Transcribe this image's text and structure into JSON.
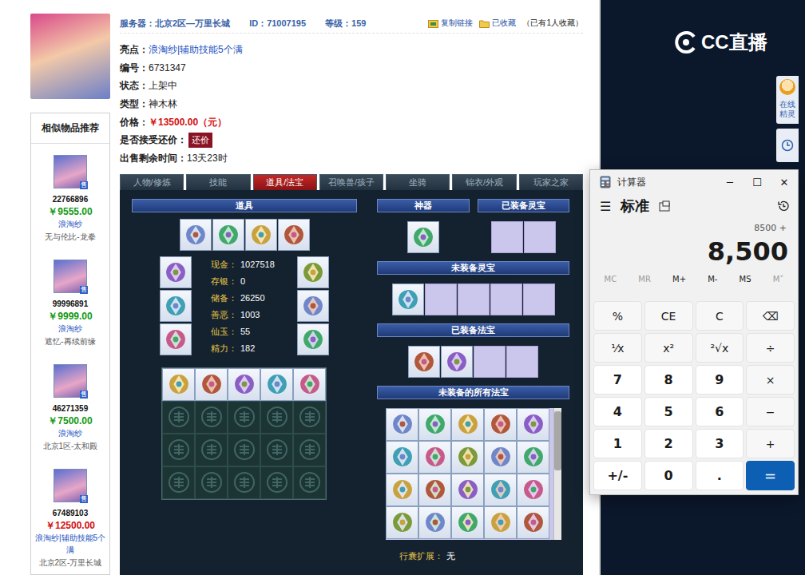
{
  "header": {
    "server": "服务器：北京2区—万里长城",
    "id": "ID：71007195",
    "level": "等级：159",
    "copy_link": "复制链接",
    "favorite": "已收藏",
    "favorite_count": "（已有1人收藏）"
  },
  "info": [
    {
      "label": "亮点：",
      "value": "浪淘纱|辅助技能5个满",
      "kind": "link"
    },
    {
      "label": "编号：",
      "value": "6731347",
      "kind": "text"
    },
    {
      "label": "状态：",
      "value": "上架中",
      "kind": "text"
    },
    {
      "label": "类型：",
      "value": "神木林",
      "kind": "text"
    },
    {
      "label": "价格：",
      "value": "￥13500.00（元）",
      "kind": "price"
    },
    {
      "label": "是否接受还价：",
      "value": "还价",
      "kind": "button"
    },
    {
      "label": "出售剩余时间：",
      "value": "13天23时",
      "kind": "text"
    }
  ],
  "similar": {
    "title": "相似物品推荐",
    "items": [
      {
        "id": "22766896",
        "price": "￥9555.00",
        "color": "#139a13",
        "tag": "浪淘纱",
        "server": "无与伦比-龙拳",
        "badge": "售"
      },
      {
        "id": "99996891",
        "price": "￥9999.00",
        "color": "#139a13",
        "tag": "浪淘纱",
        "server": "遮忆-再续前缘",
        "badge": "售"
      },
      {
        "id": "46271359",
        "price": "￥7500.00",
        "color": "#139a13",
        "tag": "浪淘纱",
        "server": "北京1区-太和殿",
        "badge": "售"
      },
      {
        "id": "67489103",
        "price": "￥12500.00",
        "color": "#d41010",
        "tag": "浪淘纱|辅助技能5个满",
        "server": "北京2区-万里长城",
        "badge": "售"
      }
    ]
  },
  "tabs": [
    {
      "label": "人物/修炼",
      "selected": false
    },
    {
      "label": "技能",
      "selected": false
    },
    {
      "label": "道具/法宝",
      "selected": true
    },
    {
      "label": "召唤兽/孩子",
      "selected": false
    },
    {
      "label": "坐骑",
      "selected": false
    },
    {
      "label": "锦衣/外观",
      "selected": false
    },
    {
      "label": "玩家之家",
      "selected": false
    }
  ],
  "items_panel": {
    "title": "道具",
    "equip_top": [
      {
        "filled": true
      },
      {
        "filled": true
      },
      {
        "filled": true
      },
      {
        "filled": true
      }
    ],
    "equip_left": [
      {
        "filled": true
      },
      {
        "filled": true
      },
      {
        "filled": true
      }
    ],
    "equip_right": [
      {
        "filled": true
      },
      {
        "filled": true
      },
      {
        "filled": true
      }
    ],
    "stats": [
      {
        "label": "现金：",
        "value": "1027518"
      },
      {
        "label": "存银：",
        "value": "0"
      },
      {
        "label": "储备：",
        "value": "26250"
      },
      {
        "label": "善恶：",
        "value": "1003"
      },
      {
        "label": "仙玉：",
        "value": "55"
      },
      {
        "label": "精力：",
        "value": "182"
      }
    ],
    "bag": [
      {
        "filled": true
      },
      {
        "filled": true
      },
      {
        "filled": true
      },
      {
        "filled": true
      },
      {
        "filled": true
      },
      {
        "filled": false
      },
      {
        "filled": false
      },
      {
        "filled": false
      },
      {
        "filled": false
      },
      {
        "filled": false
      },
      {
        "filled": false
      },
      {
        "filled": false
      },
      {
        "filled": false
      },
      {
        "filled": false
      },
      {
        "filled": false
      },
      {
        "filled": false
      },
      {
        "filled": false
      },
      {
        "filled": false
      },
      {
        "filled": false
      },
      {
        "filled": false
      }
    ]
  },
  "artifact": {
    "title": "神器",
    "slots": [
      {
        "filled": true
      }
    ]
  },
  "equipped_lingbao": {
    "title": "已装备灵宝",
    "slots": [
      {
        "filled": false
      },
      {
        "filled": false
      }
    ]
  },
  "unequipped_lingbao": {
    "title": "未装备灵宝",
    "slots": [
      {
        "filled": true
      },
      {
        "filled": false
      },
      {
        "filled": false
      },
      {
        "filled": false
      },
      {
        "filled": false
      }
    ]
  },
  "equipped_fabao": {
    "title": "已装备法宝",
    "slots": [
      {
        "filled": true
      },
      {
        "filled": true
      },
      {
        "filled": false
      },
      {
        "filled": false
      }
    ]
  },
  "all_fabao": {
    "title": "未装备的所有法宝",
    "scroll_level": 0.45,
    "slots": [
      {
        "filled": true
      },
      {
        "filled": true
      },
      {
        "filled": true
      },
      {
        "filled": true
      },
      {
        "filled": true
      },
      {
        "filled": true
      },
      {
        "filled": true
      },
      {
        "filled": true
      },
      {
        "filled": true
      },
      {
        "filled": true
      },
      {
        "filled": true
      },
      {
        "filled": true
      },
      {
        "filled": true
      },
      {
        "filled": true
      },
      {
        "filled": true
      },
      {
        "filled": true
      },
      {
        "filled": true
      },
      {
        "filled": true
      },
      {
        "filled": true
      },
      {
        "filled": true
      }
    ]
  },
  "bag_expansion": {
    "label": "行囊扩展：",
    "value": "无"
  },
  "brand": {
    "logo": "CC直播"
  },
  "side_tab": {
    "label": "在线精灵"
  },
  "calculator": {
    "title": "计算器",
    "controls": [
      "─",
      "☐",
      "✕"
    ],
    "menu": "☰",
    "mode": "标准",
    "expression": "8500 +",
    "display": "8,500",
    "memory": [
      {
        "label": "MC",
        "disabled": true
      },
      {
        "label": "MR",
        "disabled": true
      },
      {
        "label": "M+",
        "disabled": false
      },
      {
        "label": "M-",
        "disabled": false
      },
      {
        "label": "MS",
        "disabled": false
      },
      {
        "label": "M˅",
        "disabled": true
      }
    ],
    "keys": [
      {
        "label": "%",
        "kind": "fn"
      },
      {
        "label": "CE",
        "kind": "fn"
      },
      {
        "label": "C",
        "kind": "fn"
      },
      {
        "label": "⌫",
        "kind": "fn"
      },
      {
        "label": "⅟x",
        "kind": "fn"
      },
      {
        "label": "x²",
        "kind": "fn"
      },
      {
        "label": "²√x",
        "kind": "fn"
      },
      {
        "label": "÷",
        "kind": "fn"
      },
      {
        "label": "7",
        "kind": "num"
      },
      {
        "label": "8",
        "kind": "num"
      },
      {
        "label": "9",
        "kind": "num"
      },
      {
        "label": "×",
        "kind": "fn"
      },
      {
        "label": "4",
        "kind": "num"
      },
      {
        "label": "5",
        "kind": "num"
      },
      {
        "label": "6",
        "kind": "num"
      },
      {
        "label": "−",
        "kind": "fn"
      },
      {
        "label": "1",
        "kind": "num"
      },
      {
        "label": "2",
        "kind": "num"
      },
      {
        "label": "3",
        "kind": "num"
      },
      {
        "label": "+",
        "kind": "fn"
      },
      {
        "label": "+/-",
        "kind": "num"
      },
      {
        "label": "0",
        "kind": "num"
      },
      {
        "label": ".",
        "kind": "num"
      },
      {
        "label": "=",
        "kind": "equals"
      }
    ]
  }
}
